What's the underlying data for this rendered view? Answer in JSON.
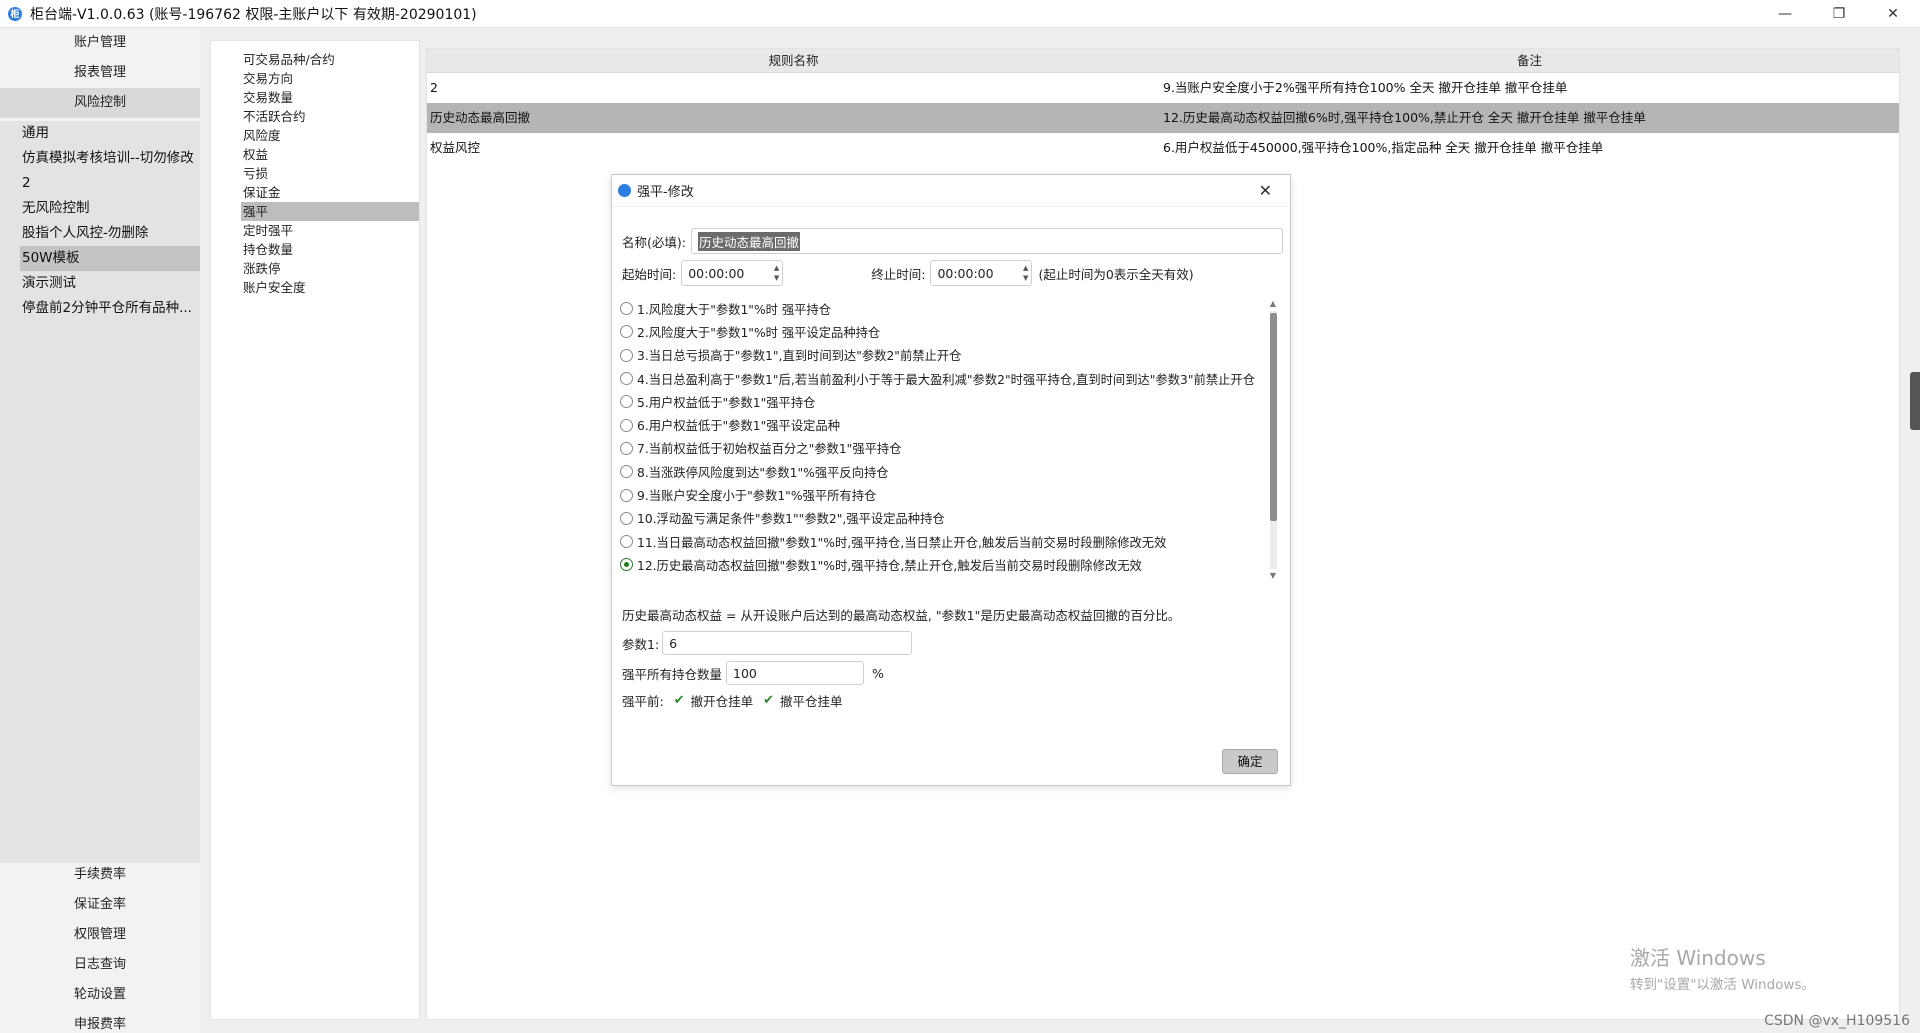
{
  "window": {
    "title": "柜台端-V1.0.0.63 (账号-196762 权限-主账户以下 有效期-20290101)",
    "minimize": "—",
    "maximize": "❐",
    "close": "✕"
  },
  "nav_top": [
    "账户管理",
    "报表管理",
    "风险控制"
  ],
  "risk_templates": [
    "通用",
    "仿真模拟考核培训--切勿修改",
    "2",
    "无风险控制",
    "股指个人风控-勿删除",
    "50W模板",
    "演示测试",
    "停盘前2分钟平仓所有品种..."
  ],
  "nav_bottom": [
    "手续费率",
    "保证金率",
    "权限管理",
    "日志查询",
    "轮动设置",
    "申报费率"
  ],
  "categories": [
    "可交易品种/合约",
    "交易方向",
    "交易数量",
    "不活跃合约",
    "风险度",
    "权益",
    "亏损",
    "保证金",
    "强平",
    "定时强平",
    "持仓数量",
    "涨跌停",
    "账户安全度"
  ],
  "table": {
    "headers": [
      "规则名称",
      "备注"
    ],
    "rows": [
      {
        "name": "2",
        "note": "9.当账户安全度小于2%强平所有持仓100% 全天 撤开仓挂单 撤平仓挂单"
      },
      {
        "name": "历史动态最高回撤",
        "note": "12.历史最高动态权益回撤6%时,强平持仓100%,禁止开仓 全天 撤开仓挂单 撤平仓挂单"
      },
      {
        "name": "权益风控",
        "note": "6.用户权益低于450000,强平持仓100%,指定品种 全天 撤开仓挂单 撤平仓挂单"
      }
    ]
  },
  "dialog": {
    "title": "强平-修改",
    "close": "✕",
    "name_label": "名称(必填):",
    "name_value": "历史动态最高回撤",
    "start_label": "起始时间:",
    "start_value": "00:00:00",
    "end_label": "终止时间:",
    "end_value": "00:00:00",
    "time_hint": "(起止时间为0表示全天有效)",
    "options": [
      "1.风险度大于\"参数1\"%时 强平持仓",
      "2.风险度大于\"参数1\"%时 强平设定品种持仓",
      "3.当日总亏损高于\"参数1\",直到时间到达\"参数2\"前禁止开仓",
      "4.当日总盈利高于\"参数1\"后,若当前盈利小于等于最大盈利减\"参数2\"时强平持仓,直到时间到达\"参数3\"前禁止开仓",
      "5.用户权益低于\"参数1\"强平持仓",
      "6.用户权益低于\"参数1\"强平设定品种",
      "7.当前权益低于初始权益百分之\"参数1\"强平持仓",
      "8.当涨跌停风险度到达\"参数1\"%强平反向持仓",
      "9.当账户安全度小于\"参数1\"%强平所有持仓",
      "10.浮动盈亏满足条件\"参数1\"\"参数2\",强平设定品种持仓",
      "11.当日最高动态权益回撤\"参数1\"%时,强平持仓,当日禁止开仓,触发后当前交易时段删除修改无效",
      "12.历史最高动态权益回撤\"参数1\"%时,强平持仓,禁止开仓,触发后当前交易时段删除修改无效"
    ],
    "selected_option": 11,
    "description": "历史最高动态权益 = 从开设账户后达到的最高动态权益, \"参数1\"是历史最高动态权益回撤的百分比。",
    "param1_label": "参数1:",
    "param1_value": "6",
    "qty_label": "强平所有持仓数量",
    "qty_value": "100",
    "qty_unit": "%",
    "before_label": "强平前:",
    "check1": "撤开仓挂单",
    "check2": "撤平仓挂单",
    "ok": "确定"
  },
  "watermark": {
    "title": "激活 Windows",
    "sub": "转到\"设置\"以激活 Windows。"
  },
  "credit": "CSDN @vx_H109516"
}
